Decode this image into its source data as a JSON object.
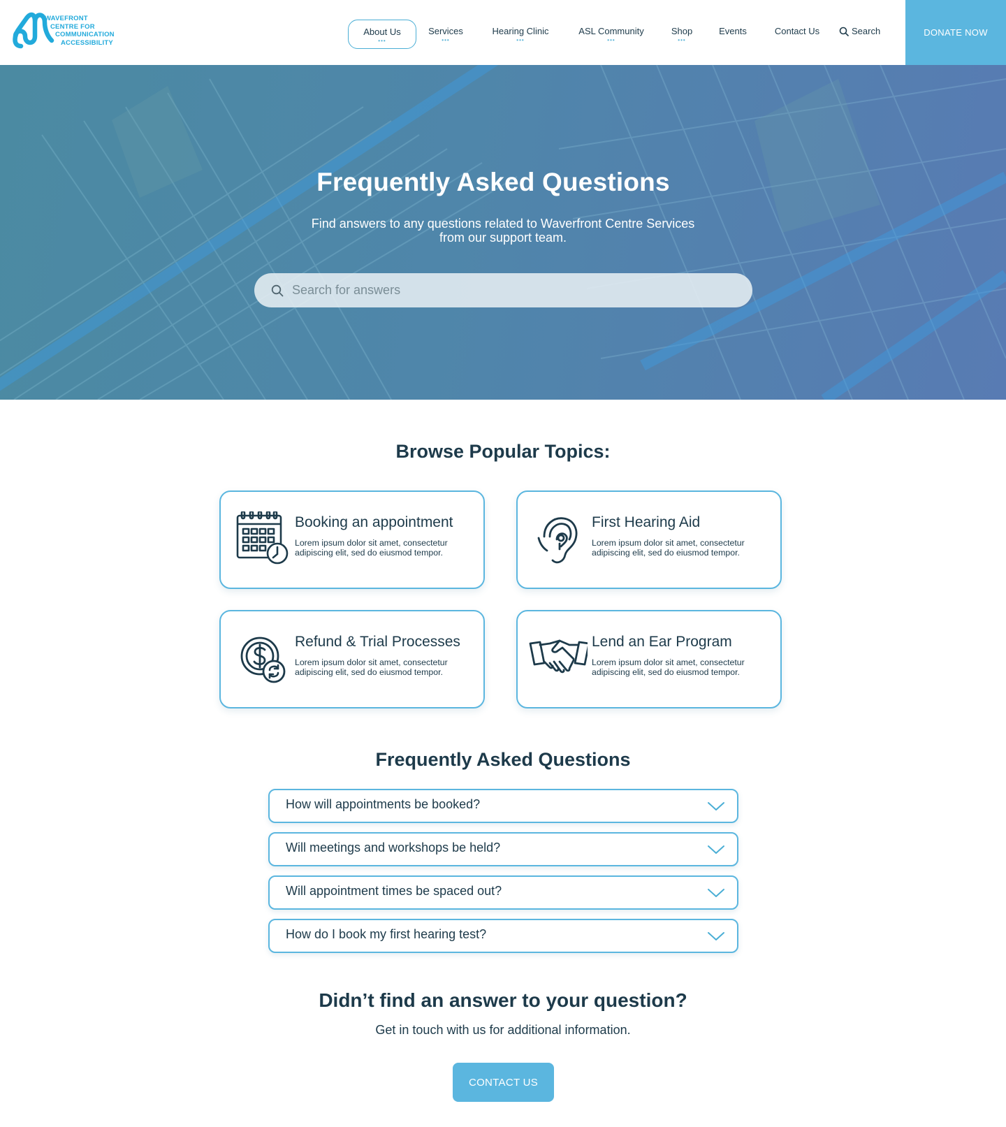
{
  "brand": {
    "logo_lines": [
      "WAVEFRONT",
      "CENTRE FOR",
      "COMMUNICATION",
      "ACCESSIBILITY"
    ],
    "accent_color": "#22aadb",
    "donate_color": "#5bb6df"
  },
  "nav": {
    "items": [
      {
        "label": "About Us",
        "dots": "•••",
        "active": true
      },
      {
        "label": "Services",
        "dots": "•••"
      },
      {
        "label": "Hearing Clinic",
        "dots": "•••"
      },
      {
        "label": "ASL Community",
        "dots": "•••"
      },
      {
        "label": "Shop",
        "dots": "•••"
      },
      {
        "label": "Events",
        "dots": ""
      },
      {
        "label": "Contact Us",
        "dots": ""
      }
    ],
    "search_label": "Search",
    "donate_label": "DONATE NOW"
  },
  "hero": {
    "title": "Frequently Asked Questions",
    "subtitle_line1": "Find answers to any questions related to Waverfront Centre Services",
    "subtitle_line2": "from our support team.",
    "search_placeholder": "Search for answers"
  },
  "topics": {
    "heading": "Browse Popular Topics:",
    "cards": [
      {
        "title": "Booking an appointment",
        "desc": "Lorem ipsum dolor sit amet, consectetur adipiscing elit, sed do eiusmod tempor.",
        "icon": "calendar-clock-icon"
      },
      {
        "title": "First Hearing Aid",
        "desc": "Lorem ipsum dolor sit amet, consectetur adipiscing elit, sed do eiusmod tempor.",
        "icon": "ear-icon"
      },
      {
        "title": "Refund & Trial Processes",
        "desc": "Lorem ipsum dolor sit amet, consectetur adipiscing elit, sed do eiusmod tempor.",
        "icon": "coin-refund-icon"
      },
      {
        "title": "Lend an Ear Program",
        "desc": "Lorem ipsum dolor sit amet, consectetur adipiscing elit, sed do eiusmod tempor.",
        "icon": "handshake-icon"
      }
    ]
  },
  "faq": {
    "heading": "Frequently Asked Questions",
    "items": [
      {
        "question": "How will appointments be booked?"
      },
      {
        "question": "Will meetings and workshops be held?"
      },
      {
        "question": "Will appointment times be spaced out?"
      },
      {
        "question": "How do I book my first hearing test?"
      }
    ]
  },
  "cta": {
    "title": "Didn’t find an answer to your question?",
    "subtitle": "Get in touch with us for additional information.",
    "button_label": "CONTACT US"
  }
}
